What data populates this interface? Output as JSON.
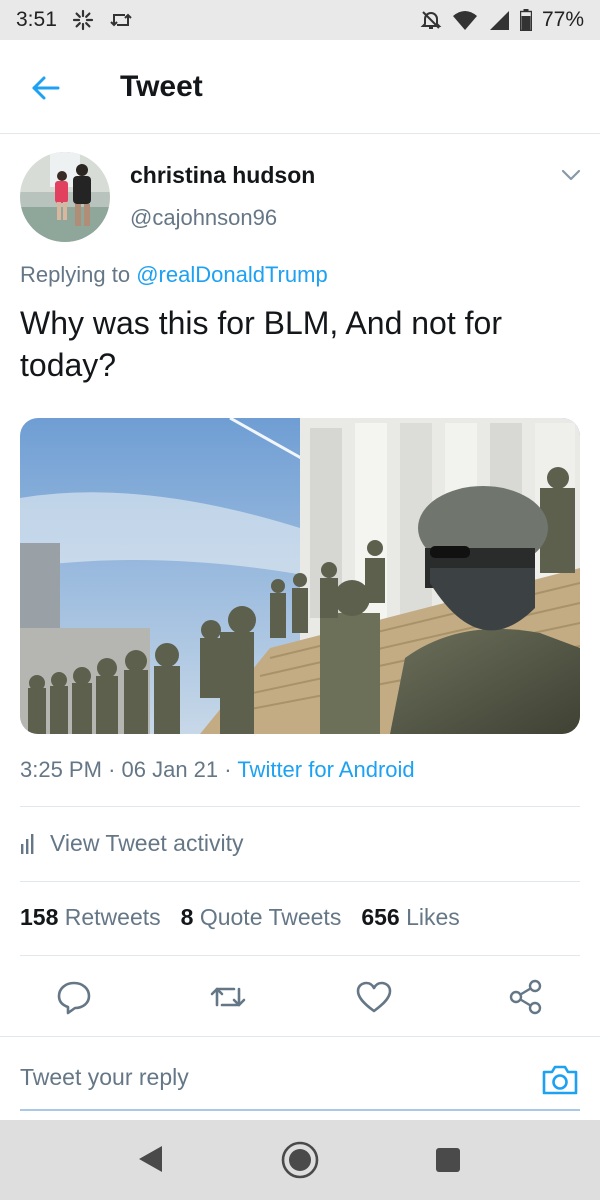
{
  "status_bar": {
    "time": "3:51",
    "battery": "77%",
    "icons": [
      "fan-icon",
      "retweet-notification-icon",
      "mute-icon",
      "wifi-icon",
      "signal-icon",
      "battery-icon"
    ]
  },
  "header": {
    "title": "Tweet",
    "back_icon": "arrow-left-icon"
  },
  "tweet": {
    "author_name": "christina hudson",
    "author_handle": "@cajohnson96",
    "replying_prefix": "Replying to",
    "replying_to": "@realDonaldTrump",
    "text": "Why was this for BLM, And not for today?",
    "time": "3:25 PM",
    "date": "06 Jan 21",
    "source": "Twitter for Android",
    "separator": "·"
  },
  "activity": {
    "label": "View Tweet activity"
  },
  "stats": {
    "retweets_count": "158",
    "retweets_label": "Retweets",
    "quotes_count": "8",
    "quotes_label": "Quote Tweets",
    "likes_count": "656",
    "likes_label": "Likes"
  },
  "actions": [
    "reply-icon",
    "retweet-icon",
    "like-icon",
    "share-icon"
  ],
  "reply_box": {
    "placeholder": "Tweet your reply"
  },
  "colors": {
    "accent": "#1da1f2",
    "text_primary": "#14171a",
    "text_secondary": "#657786",
    "divider": "#e1e8ed"
  }
}
